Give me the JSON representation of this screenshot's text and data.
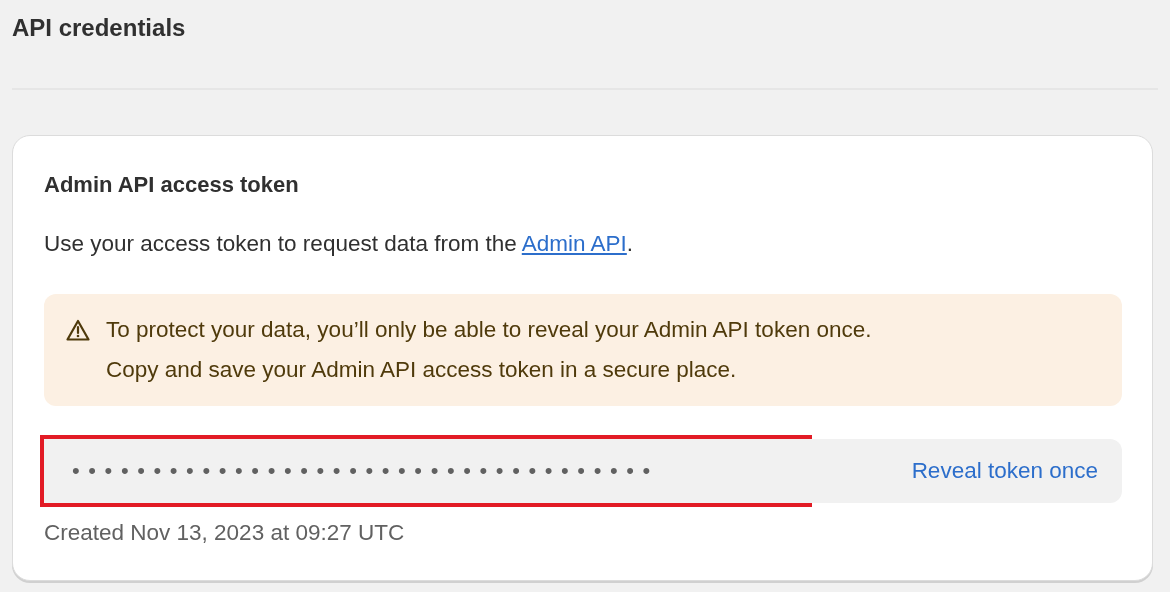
{
  "page": {
    "title": "API credentials"
  },
  "card": {
    "heading": "Admin API access token",
    "description": {
      "before": "Use your access token to request data from the ",
      "link": "Admin API",
      "after": "."
    },
    "banner": {
      "kind": "warning",
      "lines": [
        "To protect your data, you’ll only be able to reveal your Admin API token once.",
        "Copy and save your Admin API access token in a secure place."
      ]
    },
    "token_field": {
      "value": "••••••••••••••••••••••••••••••••••••",
      "highlighted": true
    },
    "reveal_button": "Reveal token once",
    "created": "Created Nov 13, 2023 at 09:27 UTC"
  }
}
